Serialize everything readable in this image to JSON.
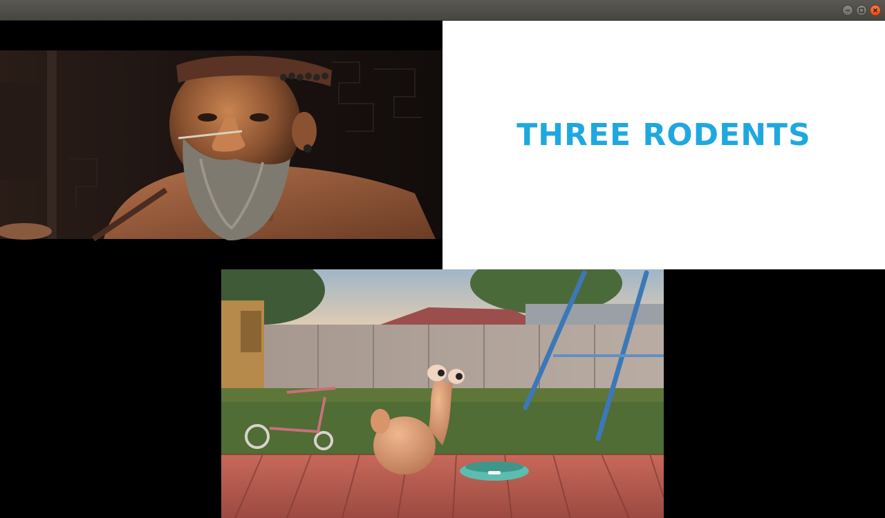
{
  "window": {
    "title": "",
    "controls": {
      "minimize_icon": "minimize-icon",
      "maximize_icon": "maximize-icon",
      "close_icon": "close-icon"
    }
  },
  "panes": {
    "top_left": {
      "content": "animated-old-man-with-beard-frame"
    },
    "top_right": {
      "title_text": "THREE RODENTS",
      "text_color": "#1fa8e0",
      "background": "#ffffff"
    },
    "bottom": {
      "content": "animated-backyard-creature-with-bowl-frame"
    }
  },
  "colors": {
    "titlebar": "#4f4d47",
    "close_button": "#e95420",
    "background": "#000000"
  }
}
